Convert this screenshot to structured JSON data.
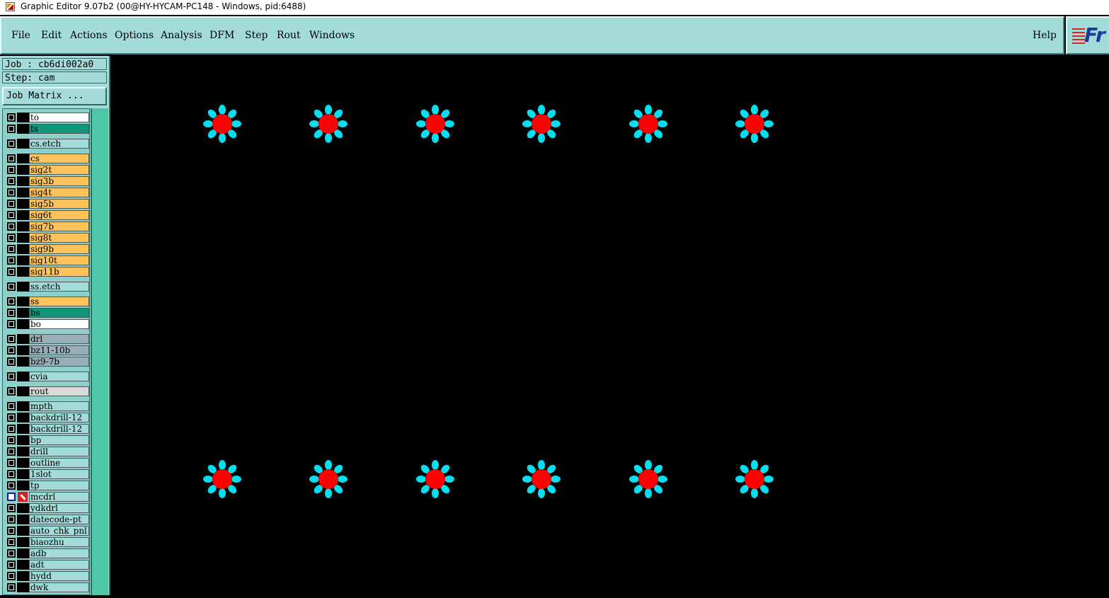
{
  "window": {
    "title": "Graphic Editor 9.07b2 (00@HY-HYCAM-PC148 - Windows, pid:6488)"
  },
  "menu": {
    "items": [
      "File",
      "Edit",
      "Actions",
      "Options",
      "Analysis",
      "DFM",
      "Step",
      "Rout",
      "Windows"
    ],
    "help": "Help"
  },
  "logo": {
    "text": "Fr"
  },
  "job": {
    "label": "Job : cb6di002a0",
    "step_label": "Step: cam",
    "matrix_button": "Job Matrix ..."
  },
  "colors": {
    "panel": "#a3dbd9",
    "outer_layer": "#ffffff",
    "mask_layer": "#12957a",
    "etch_layer": "#a3dbd9",
    "signal_layer": "#ffc35a",
    "drill_layer": "#98aeb8",
    "rout_layer": "#d9d9d9",
    "misc_layer": "#a3dbd9",
    "pad_center": "#ff0000",
    "pad_ring": "#00e0f0"
  },
  "layers": [
    {
      "name": "to",
      "type": "outer_layer"
    },
    {
      "name": "ts",
      "type": "mask_layer"
    },
    {
      "name": "cs.etch",
      "type": "etch_layer"
    },
    {
      "name": "cs",
      "type": "signal_layer"
    },
    {
      "name": "sig2t",
      "type": "signal_layer"
    },
    {
      "name": "sig3b",
      "type": "signal_layer"
    },
    {
      "name": "sig4t",
      "type": "signal_layer"
    },
    {
      "name": "sig5b",
      "type": "signal_layer"
    },
    {
      "name": "sig6t",
      "type": "signal_layer"
    },
    {
      "name": "sig7b",
      "type": "signal_layer"
    },
    {
      "name": "sig8t",
      "type": "signal_layer"
    },
    {
      "name": "sig9b",
      "type": "signal_layer"
    },
    {
      "name": "sig10t",
      "type": "signal_layer"
    },
    {
      "name": "sig11b",
      "type": "signal_layer"
    },
    {
      "name": "ss.etch",
      "type": "etch_layer"
    },
    {
      "name": "ss",
      "type": "signal_layer"
    },
    {
      "name": "bs",
      "type": "mask_layer"
    },
    {
      "name": "bo",
      "type": "outer_layer"
    },
    {
      "name": "drl",
      "type": "drill_layer"
    },
    {
      "name": "bz11-10b",
      "type": "drill_layer"
    },
    {
      "name": "bz9-7b",
      "type": "drill_layer"
    },
    {
      "name": "cvia",
      "type": "misc_layer"
    },
    {
      "name": "rout",
      "type": "rout_layer"
    },
    {
      "name": "mpth",
      "type": "misc_layer"
    },
    {
      "name": "backdrill-12",
      "type": "misc_layer"
    },
    {
      "name": "backdrill-12",
      "type": "misc_layer"
    },
    {
      "name": "bp",
      "type": "misc_layer"
    },
    {
      "name": "drill",
      "type": "misc_layer"
    },
    {
      "name": "outline",
      "type": "misc_layer"
    },
    {
      "name": "1slot",
      "type": "misc_layer"
    },
    {
      "name": "tp",
      "type": "misc_layer"
    },
    {
      "name": "mcdrl",
      "type": "misc_layer",
      "active": true
    },
    {
      "name": "ydkdrl",
      "type": "misc_layer"
    },
    {
      "name": "datecode-pt",
      "type": "misc_layer"
    },
    {
      "name": "auto_chk_pnl",
      "type": "misc_layer"
    },
    {
      "name": "biaozhu",
      "type": "misc_layer"
    },
    {
      "name": "adb",
      "type": "misc_layer"
    },
    {
      "name": "adt",
      "type": "misc_layer"
    },
    {
      "name": "hydd",
      "type": "misc_layer"
    },
    {
      "name": "dwk",
      "type": "misc_layer"
    }
  ],
  "canvas": {
    "pad_rows": 2,
    "pads_per_row": 6,
    "petals_per_pad": 8
  }
}
